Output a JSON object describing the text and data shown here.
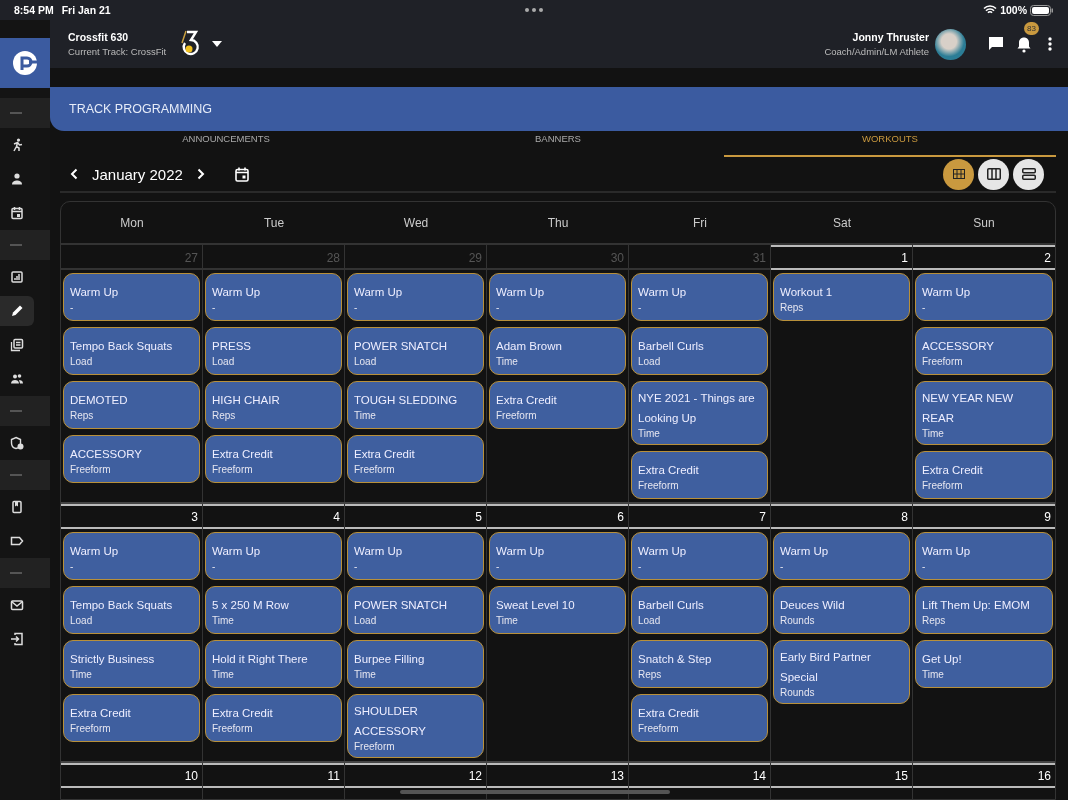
{
  "status_bar": {
    "time": "8:54 PM",
    "date": "Fri Jan 21",
    "battery": "100%"
  },
  "sidebar": {
    "items": [
      {
        "kind": "separator"
      },
      {
        "kind": "nav",
        "selected": false
      },
      {
        "kind": "nav",
        "selected": false
      },
      {
        "kind": "nav",
        "selected": false
      },
      {
        "kind": "separator"
      },
      {
        "kind": "nav",
        "selected": false
      },
      {
        "kind": "nav",
        "selected": true
      },
      {
        "kind": "nav",
        "selected": false
      },
      {
        "kind": "nav",
        "selected": false
      },
      {
        "kind": "separator"
      },
      {
        "kind": "nav",
        "selected": false
      },
      {
        "kind": "separator"
      },
      {
        "kind": "nav",
        "selected": false
      },
      {
        "kind": "nav",
        "selected": false
      },
      {
        "kind": "separator"
      },
      {
        "kind": "nav",
        "selected": false
      },
      {
        "kind": "nav",
        "selected": false
      }
    ]
  },
  "header": {
    "gym": "Crossfit 630",
    "track": "Current Track: CrossFit",
    "user_name": "Jonny Thruster",
    "user_role": "Coach/Admin/LM Athlete",
    "notifications": "83"
  },
  "banner": {
    "title": "TRACK PROGRAMMING"
  },
  "tabs": [
    {
      "label": "ANNOUNCEMENTS",
      "selected": false
    },
    {
      "label": "BANNERS",
      "selected": false
    },
    {
      "label": "WORKOUTS",
      "selected": true
    }
  ],
  "calendar_nav": {
    "month": "January 2022"
  },
  "view_modes": [
    {
      "selected": true
    },
    {
      "selected": false
    },
    {
      "selected": false
    }
  ],
  "calendar": {
    "weekdays": [
      "Mon",
      "Tue",
      "Wed",
      "Thu",
      "Fri",
      "Sat",
      "Sun"
    ],
    "weeks": [
      {
        "days": [
          {
            "number": "27",
            "in_month": false,
            "workouts": [
              {
                "name": "Warm Up",
                "type": "-"
              },
              {
                "name": "Tempo Back Squats",
                "type": "Load"
              },
              {
                "name": "DEMOTED",
                "type": "Reps"
              },
              {
                "name": "ACCESSORY",
                "type": "Freeform"
              }
            ]
          },
          {
            "number": "28",
            "in_month": false,
            "workouts": [
              {
                "name": "Warm Up",
                "type": "-"
              },
              {
                "name": "PRESS",
                "type": "Load"
              },
              {
                "name": "HIGH CHAIR",
                "type": "Reps"
              },
              {
                "name": "Extra Credit",
                "type": "Freeform"
              }
            ]
          },
          {
            "number": "29",
            "in_month": false,
            "workouts": [
              {
                "name": "Warm Up",
                "type": "-"
              },
              {
                "name": "POWER SNATCH",
                "type": "Load"
              },
              {
                "name": "TOUGH SLEDDING",
                "type": "Time"
              },
              {
                "name": "Extra Credit",
                "type": "Freeform"
              }
            ]
          },
          {
            "number": "30",
            "in_month": false,
            "workouts": [
              {
                "name": "Warm Up",
                "type": "-"
              },
              {
                "name": "Adam Brown",
                "type": "Time"
              },
              {
                "name": "Extra Credit",
                "type": "Freeform"
              }
            ]
          },
          {
            "number": "31",
            "in_month": false,
            "workouts": [
              {
                "name": "Warm Up",
                "type": "-"
              },
              {
                "name": "Barbell Curls",
                "type": "Load"
              },
              {
                "name": "NYE 2021 - Things are Looking Up",
                "type": "Time"
              },
              {
                "name": "Extra Credit",
                "type": "Freeform"
              }
            ]
          },
          {
            "number": "1",
            "in_month": true,
            "workouts": [
              {
                "name": "Workout 1",
                "type": "Reps"
              }
            ]
          },
          {
            "number": "2",
            "in_month": true,
            "workouts": [
              {
                "name": "Warm Up",
                "type": "-"
              },
              {
                "name": "ACCESSORY",
                "type": "Freeform"
              },
              {
                "name": "NEW YEAR NEW REAR",
                "type": "Time"
              },
              {
                "name": "Extra Credit",
                "type": "Freeform"
              }
            ]
          }
        ]
      },
      {
        "days": [
          {
            "number": "3",
            "in_month": true,
            "workouts": [
              {
                "name": "Warm Up",
                "type": "-"
              },
              {
                "name": "Tempo Back Squats",
                "type": "Load"
              },
              {
                "name": "Strictly Business",
                "type": "Time"
              },
              {
                "name": "Extra Credit",
                "type": "Freeform"
              }
            ]
          },
          {
            "number": "4",
            "in_month": true,
            "workouts": [
              {
                "name": "Warm Up",
                "type": "-"
              },
              {
                "name": "5 x 250 M Row",
                "type": "Time"
              },
              {
                "name": "Hold it Right There",
                "type": "Time"
              },
              {
                "name": "Extra Credit",
                "type": "Freeform"
              }
            ]
          },
          {
            "number": "5",
            "in_month": true,
            "workouts": [
              {
                "name": "Warm Up",
                "type": "-"
              },
              {
                "name": "POWER SNATCH",
                "type": "Load"
              },
              {
                "name": "Burpee Filling",
                "type": "Time"
              },
              {
                "name": "SHOULDER ACCESSORY",
                "type": "Freeform"
              }
            ]
          },
          {
            "number": "6",
            "in_month": true,
            "workouts": [
              {
                "name": "Warm Up",
                "type": "-"
              },
              {
                "name": "Sweat Level 10",
                "type": "Time"
              }
            ]
          },
          {
            "number": "7",
            "in_month": true,
            "workouts": [
              {
                "name": "Warm Up",
                "type": "-"
              },
              {
                "name": "Barbell Curls",
                "type": "Load"
              },
              {
                "name": "Snatch & Step",
                "type": "Reps"
              },
              {
                "name": "Extra Credit",
                "type": "Freeform"
              }
            ]
          },
          {
            "number": "8",
            "in_month": true,
            "workouts": [
              {
                "name": "Warm Up",
                "type": "-"
              },
              {
                "name": "Deuces Wild",
                "type": "Rounds"
              },
              {
                "name": "Early Bird Partner Special",
                "type": "Rounds"
              }
            ]
          },
          {
            "number": "9",
            "in_month": true,
            "workouts": [
              {
                "name": "Warm Up",
                "type": "-"
              },
              {
                "name": "Lift Them Up: EMOM",
                "type": "Reps"
              },
              {
                "name": "Get Up!",
                "type": "Time"
              }
            ]
          }
        ]
      },
      {
        "days": [
          {
            "number": "10",
            "in_month": true
          },
          {
            "number": "11",
            "in_month": true
          },
          {
            "number": "12",
            "in_month": true
          },
          {
            "number": "13",
            "in_month": true
          },
          {
            "number": "14",
            "in_month": true
          },
          {
            "number": "15",
            "in_month": true
          },
          {
            "number": "16",
            "in_month": true
          }
        ]
      }
    ]
  }
}
